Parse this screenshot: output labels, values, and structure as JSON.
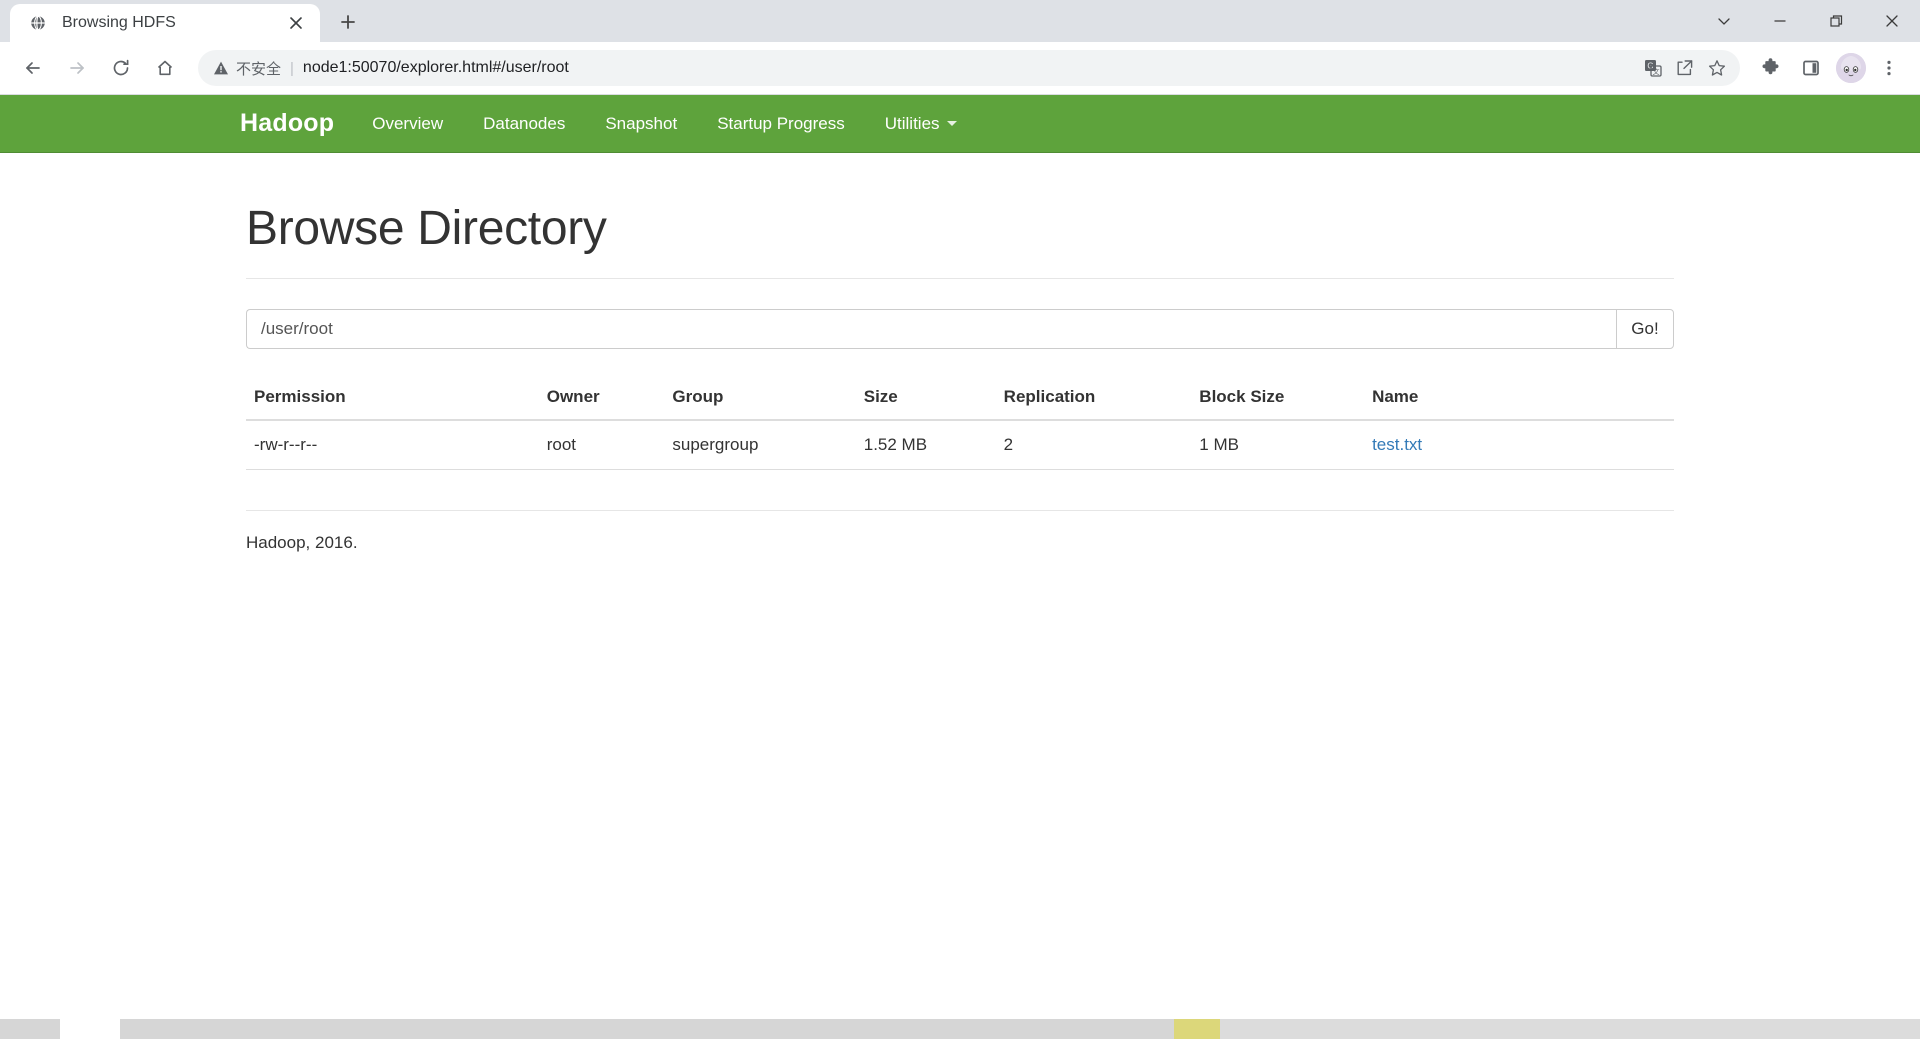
{
  "browser": {
    "tab": {
      "title": "Browsing HDFS",
      "favicon_icon": "globe-icon",
      "close_icon": "close-icon"
    },
    "new_tab_icon": "plus-icon",
    "window_controls": [
      {
        "name": "tab-search-button",
        "icon": "chevron-down-icon"
      },
      {
        "name": "minimize-button",
        "icon": "minimize-icon"
      },
      {
        "name": "maximize-button",
        "icon": "restore-icon"
      },
      {
        "name": "close-window-button",
        "icon": "close-icon"
      }
    ],
    "nav_icons": [
      {
        "name": "back-button",
        "icon": "arrow-left-icon"
      },
      {
        "name": "forward-button",
        "icon": "arrow-right-icon"
      },
      {
        "name": "reload-button",
        "icon": "reload-icon"
      },
      {
        "name": "home-button",
        "icon": "home-icon"
      }
    ],
    "omnibox": {
      "security_icon": "warning-triangle-icon",
      "security_label": "不安全",
      "separator": "|",
      "url": "node1:50070/explorer.html#/user/root",
      "inline_icons": [
        {
          "name": "translate-button",
          "icon": "translate-icon"
        },
        {
          "name": "share-button",
          "icon": "share-icon"
        },
        {
          "name": "bookmark-button",
          "icon": "star-icon"
        }
      ]
    },
    "toolbar_right": [
      {
        "name": "extensions-button",
        "icon": "puzzle-icon"
      },
      {
        "name": "side-panel-button",
        "icon": "square-panel-icon"
      },
      {
        "name": "profile-avatar",
        "icon": "avatar-icon"
      },
      {
        "name": "chrome-menu-button",
        "icon": "three-dot-menu-icon"
      }
    ]
  },
  "site": {
    "navbar": {
      "brand": "Hadoop",
      "accent_color": "#5ea33c",
      "links": [
        {
          "label": "Overview"
        },
        {
          "label": "Datanodes"
        },
        {
          "label": "Snapshot"
        },
        {
          "label": "Startup Progress"
        }
      ],
      "dropdown": {
        "label": "Utilities",
        "caret_icon": "caret-down-icon"
      }
    },
    "page_title": "Browse Directory",
    "path_form": {
      "value": "/user/root",
      "placeholder": "/user/root",
      "submit_label": "Go!"
    },
    "table": {
      "headers": [
        "Permission",
        "Owner",
        "Group",
        "Size",
        "Replication",
        "Block Size",
        "Name"
      ],
      "rows": [
        {
          "permission": "-rw-r--r--",
          "owner": "root",
          "group": "supergroup",
          "size": "1.52 MB",
          "replication": "2",
          "block_size": "1 MB",
          "name": "test.txt",
          "name_link_color": "#337ab7"
        }
      ]
    },
    "footer": "Hadoop, 2016."
  }
}
